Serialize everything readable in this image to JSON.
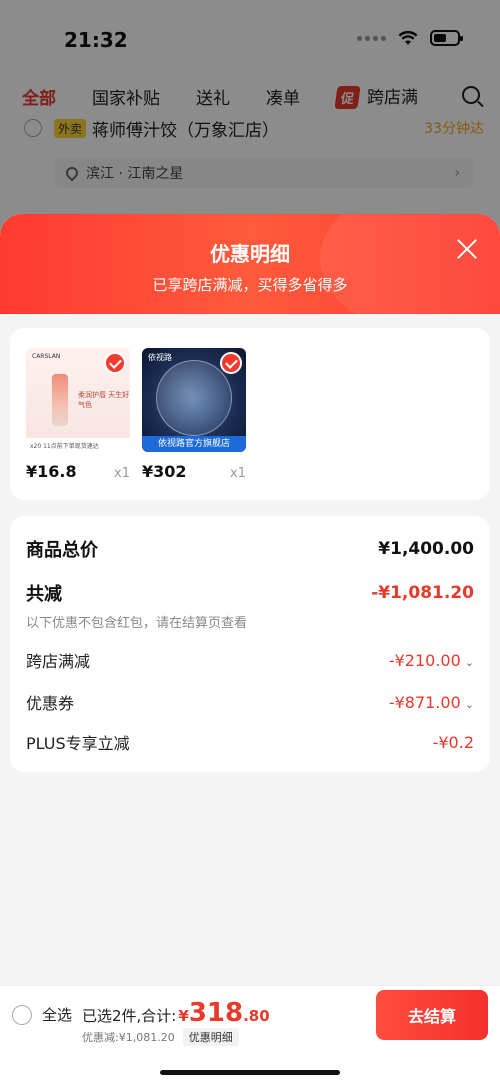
{
  "status_bar": {
    "time": "21:32"
  },
  "top_tabs": {
    "items": [
      "全部",
      "国家补贴",
      "送礼",
      "凑单"
    ],
    "promo_tag": "促",
    "promo_label": "跨店满"
  },
  "store": {
    "tag": "外卖",
    "name": "蒋师傅汁饺（万象汇店）",
    "eta": "33分钟达",
    "address": "滨江 · 江南之星"
  },
  "sheet": {
    "title": "优惠明细",
    "subtitle": "已享跨店满减，买得多省得多"
  },
  "products": [
    {
      "brand": "CARSLAN",
      "image_text": "柔润护唇 天生好气色",
      "bottom_text": "x20  11点前下单现货速达",
      "price": "¥16.8",
      "qty": "x1"
    },
    {
      "brand": "依视路",
      "banner": "依视路官方旗舰店",
      "price": "¥302",
      "qty": "x1"
    }
  ],
  "summary": {
    "total_label": "商品总价",
    "total_value": "¥1,400.00",
    "reduce_label": "共减",
    "reduce_value": "-¥1,081.20",
    "note": "以下优惠不包含红包，请在结算页查看",
    "cross_store_label": "跨店满减",
    "cross_store_value": "-¥210.00",
    "coupon_label": "优惠券",
    "coupon_value": "-¥871.00",
    "plus_label": "PLUS专享立减",
    "plus_value": "-¥0.2"
  },
  "bottom_bar": {
    "select_all": "全选",
    "selected_text": "已选2件,合计:",
    "currency": "¥",
    "total_int": "318",
    "total_dec": ".80",
    "discount": "优惠减:¥1,081.20",
    "detail_chip": "优惠明细",
    "checkout": "去结算"
  },
  "colors": {
    "accent": "#e8392a",
    "header": "#ff3b30",
    "background": "#f4f4f4"
  }
}
